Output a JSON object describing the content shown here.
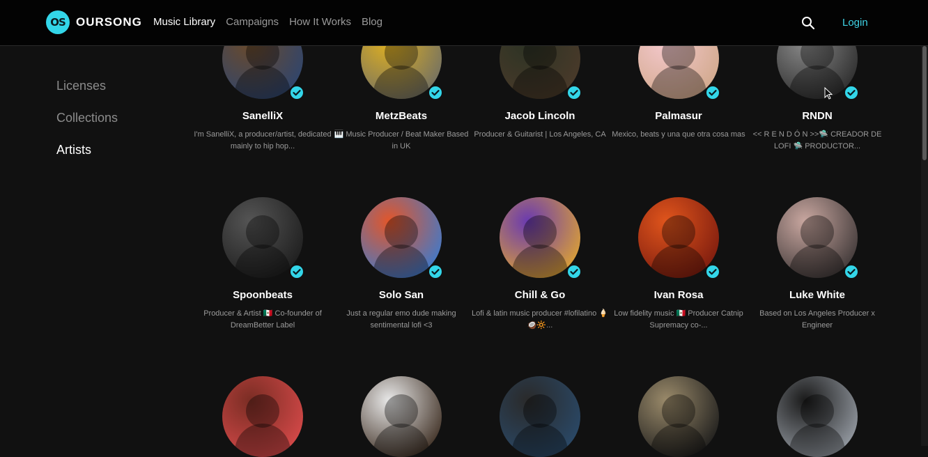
{
  "brand": {
    "name": "OURSONG",
    "mark": "OS"
  },
  "nav": [
    {
      "label": "Music Library",
      "active": true
    },
    {
      "label": "Campaigns",
      "active": false
    },
    {
      "label": "How It Works",
      "active": false
    },
    {
      "label": "Blog",
      "active": false
    }
  ],
  "header": {
    "login_label": "Login",
    "search_icon": "search-icon"
  },
  "sidebar": [
    {
      "label": "Licenses",
      "active": false
    },
    {
      "label": "Collections",
      "active": false
    },
    {
      "label": "Artists",
      "active": true
    }
  ],
  "artists": [
    {
      "name": "SanelliX",
      "bio": "I'm SanelliX, a producer/artist, dedicated mainly to hip hop...",
      "colors": [
        "#6b4a2a",
        "#2d4570"
      ]
    },
    {
      "name": "MetzBeats",
      "bio": "🎹 Music Producer / Beat Maker Based in UK",
      "colors": [
        "#e0b020",
        "#6e6e66"
      ]
    },
    {
      "name": "Jacob Lincoln",
      "bio": "Producer & Guitarist | Los Angeles, CA",
      "colors": [
        "#2c3324",
        "#4b3a2a"
      ]
    },
    {
      "name": "Palmasur",
      "bio": "Mexico, beats y una que otra cosa mas",
      "colors": [
        "#f4c8cd",
        "#d0a88a"
      ]
    },
    {
      "name": "RNDN",
      "bio": "<< R E N D Ó N >>🛸 CREADOR DE LOFI 🛸 PRODUCTOR...",
      "colors": [
        "#8a8a8a",
        "#2a2a2a"
      ]
    },
    {
      "name": "Spoonbeats",
      "bio": "Producer & Artist 🇲🇽 Co-founder of DreamBetter Label",
      "colors": [
        "#555555",
        "#1c1c1c"
      ]
    },
    {
      "name": "Solo San",
      "bio": "Just a regular emo dude making sentimental lofi <3",
      "colors": [
        "#e2562a",
        "#3a7bd0"
      ]
    },
    {
      "name": "Chill & Go",
      "bio": "Lofi & latin music producer #lofilatino 🍦🥥🔆...",
      "colors": [
        "#6a3ab0",
        "#e0a530"
      ]
    },
    {
      "name": "Ivan Rosa",
      "bio": "Low fidelity music 🇲🇽 Producer Catnip Supremacy co-...",
      "colors": [
        "#e0551c",
        "#7a1a0e"
      ]
    },
    {
      "name": "Luke White",
      "bio": "Based on Los Angeles Producer x Engineer",
      "colors": [
        "#c9a7a0",
        "#3a3434"
      ]
    },
    {
      "name": "",
      "bio": "",
      "colors": [
        "#7a2d24",
        "#d84a4a"
      ]
    },
    {
      "name": "",
      "bio": "",
      "colors": [
        "#e8e8e8",
        "#3a2a1e"
      ]
    },
    {
      "name": "",
      "bio": "",
      "colors": [
        "#2a2a2a",
        "#2a4a6a"
      ]
    },
    {
      "name": "",
      "bio": "",
      "colors": [
        "#9a8a6a",
        "#1a1a1a"
      ]
    },
    {
      "name": "",
      "bio": "",
      "colors": [
        "#1a1a1a",
        "#9aa0a8"
      ]
    }
  ],
  "accent": "#33d6e9"
}
